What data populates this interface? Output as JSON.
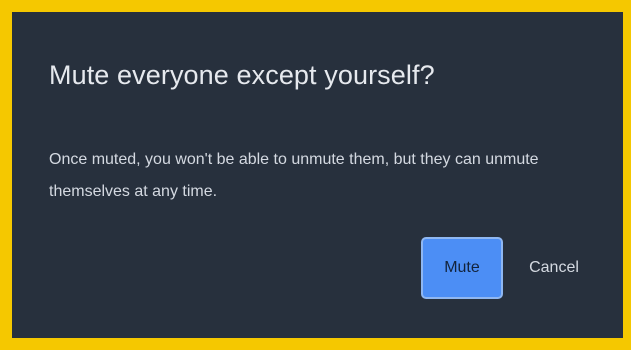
{
  "dialog": {
    "title": "Mute everyone except yourself?",
    "message": "Once muted, you won't be able to unmute them, but they can unmute themselves at any time.",
    "mute_label": "Mute",
    "cancel_label": "Cancel"
  },
  "colors": {
    "frame_border": "#f5c800",
    "dialog_background": "#27303d",
    "primary_button": "#4c8ef5",
    "primary_button_border": "#8fb7f2",
    "text": "#d4d9e1"
  }
}
